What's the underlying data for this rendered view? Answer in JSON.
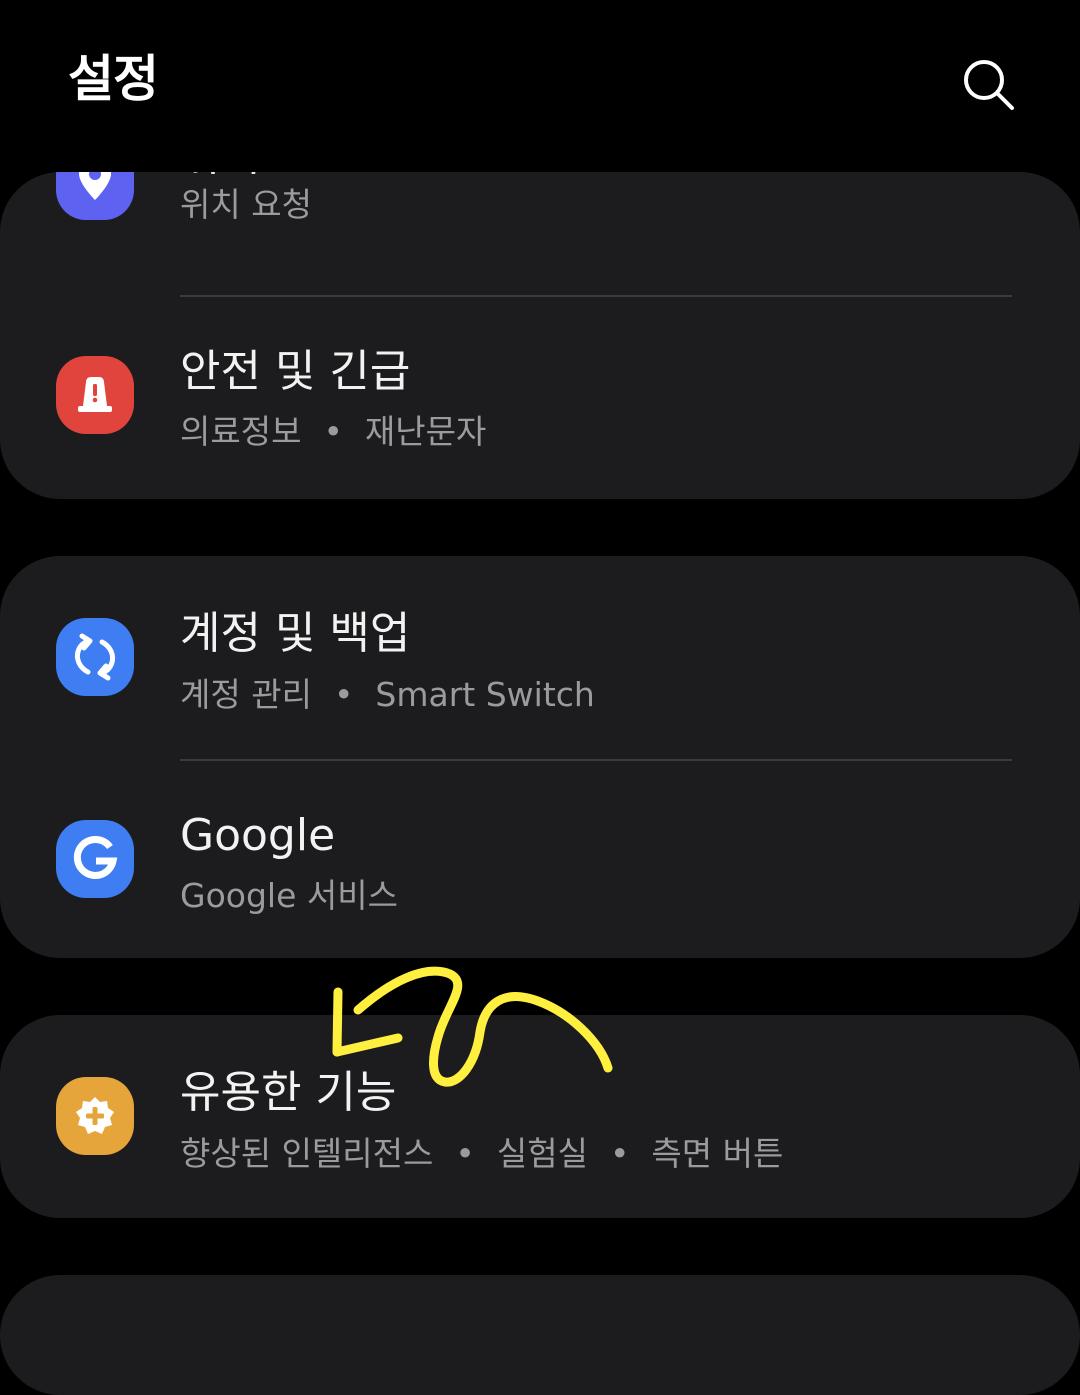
{
  "header": {
    "title": "설정"
  },
  "colors": {
    "background": "#000000",
    "card": "#1c1c1e",
    "location_icon": "#5e62f0",
    "safety_icon": "#e0443c",
    "accounts_icon": "#3f7ef2",
    "google_icon": "#3f7ef2",
    "features_icon": "#e6a53a",
    "annotation": "#fff040"
  },
  "items": [
    {
      "title": "위치",
      "subtitle": "위치 요청",
      "icon": "location-pin-icon"
    },
    {
      "title": "안전 및 긴급",
      "subtitle_parts": [
        "의료정보",
        "재난문자"
      ],
      "icon": "emergency-alert-icon"
    },
    {
      "title": "계정 및 백업",
      "subtitle_parts": [
        "계정 관리",
        "Smart Switch"
      ],
      "icon": "sync-icon"
    },
    {
      "title": "Google",
      "subtitle": "Google 서비스",
      "icon": "google-g-icon"
    },
    {
      "title": "유용한 기능",
      "subtitle_parts": [
        "향상된 인텔리전스",
        "실험실",
        "측면 버튼"
      ],
      "icon": "puzzle-gear-icon"
    }
  ],
  "separator": "•"
}
